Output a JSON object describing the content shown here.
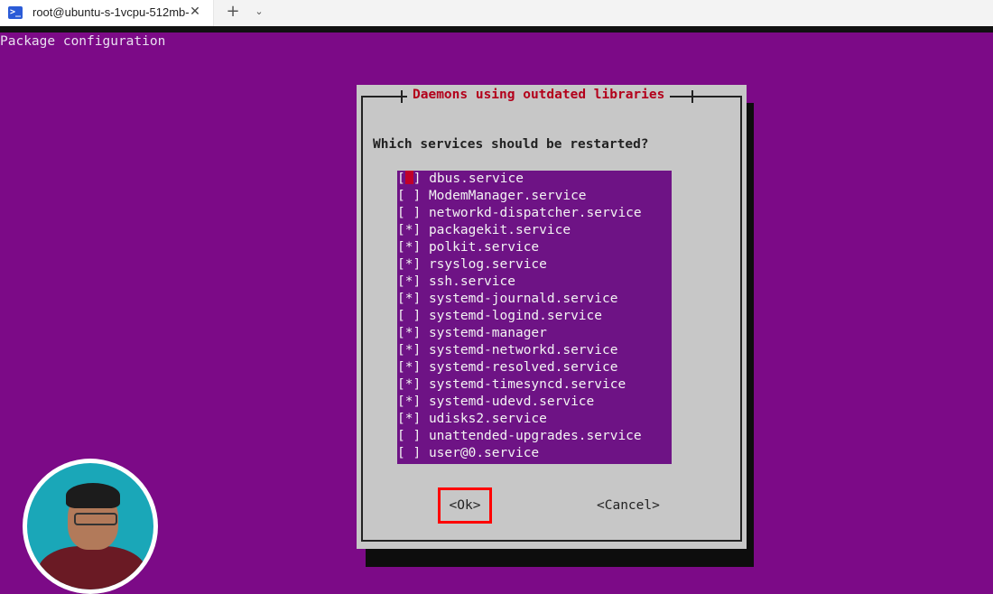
{
  "window": {
    "tab_icon": "terminal-icon",
    "tab_icon_glyph": ">_",
    "tab_title": "root@ubuntu-s-1vcpu-512mb-",
    "close_glyph": "✕",
    "new_tab_glyph": "+",
    "dropdown_glyph": "⌄"
  },
  "terminal": {
    "header": "Package configuration"
  },
  "dialog": {
    "title": "Daemons using outdated libraries",
    "question": "Which services should be restarted?",
    "services": [
      {
        "mark": "[ ]",
        "name": "dbus.service",
        "checked": false,
        "focused": true
      },
      {
        "mark": "[ ]",
        "name": "ModemManager.service",
        "checked": false
      },
      {
        "mark": "[ ]",
        "name": "networkd-dispatcher.service",
        "checked": false
      },
      {
        "mark": "[*]",
        "name": "packagekit.service",
        "checked": true
      },
      {
        "mark": "[*]",
        "name": "polkit.service",
        "checked": true
      },
      {
        "mark": "[*]",
        "name": "rsyslog.service",
        "checked": true
      },
      {
        "mark": "[*]",
        "name": "ssh.service",
        "checked": true
      },
      {
        "mark": "[*]",
        "name": "systemd-journald.service",
        "checked": true
      },
      {
        "mark": "[ ]",
        "name": "systemd-logind.service",
        "checked": false
      },
      {
        "mark": "[*]",
        "name": "systemd-manager",
        "checked": true
      },
      {
        "mark": "[*]",
        "name": "systemd-networkd.service",
        "checked": true
      },
      {
        "mark": "[*]",
        "name": "systemd-resolved.service",
        "checked": true
      },
      {
        "mark": "[*]",
        "name": "systemd-timesyncd.service",
        "checked": true
      },
      {
        "mark": "[*]",
        "name": "systemd-udevd.service",
        "checked": true
      },
      {
        "mark": "[*]",
        "name": "udisks2.service",
        "checked": true
      },
      {
        "mark": "[ ]",
        "name": "unattended-upgrades.service",
        "checked": false
      },
      {
        "mark": "[ ]",
        "name": "user@0.service",
        "checked": false
      }
    ],
    "ok_label": "<Ok>",
    "cancel_label": "<Cancel>"
  },
  "colors": {
    "terminal_bg": "#7c0a87",
    "dialog_bg": "#c7c7c7",
    "list_bg": "#6e1385",
    "title_text": "#b3001b",
    "highlight_box": "#ff0000"
  }
}
